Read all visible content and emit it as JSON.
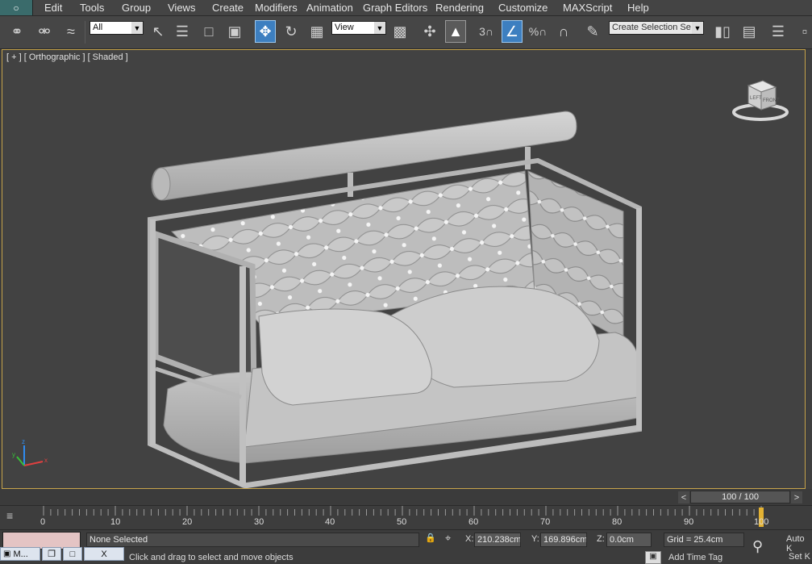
{
  "menu": {
    "items": [
      "Edit",
      "Tools",
      "Group",
      "Views",
      "Create",
      "Modifiers",
      "Animation",
      "Graph Editors",
      "Rendering",
      "Customize",
      "MAXScript",
      "Help"
    ]
  },
  "toolbar": {
    "filter_value": "All",
    "coord_value": "View",
    "snap_label": "3",
    "named_selection_placeholder": "Create Selection Se"
  },
  "viewport": {
    "label": "[ + ] [ Orthographic ] [ Shaded ]",
    "viewcube_face": "FRONT",
    "viewcube_left_face": "LEFT"
  },
  "time_slider": {
    "value": "100 / 100",
    "prev": "<",
    "next": ">"
  },
  "trackbar": {
    "ticks": [
      "0",
      "10",
      "20",
      "30",
      "40",
      "50",
      "60",
      "70",
      "80",
      "90",
      "100"
    ],
    "current_frame": 100
  },
  "status": {
    "selection": "None Selected",
    "prompt": "Click and drag to select and move objects",
    "x_label": "X:",
    "x_value": "210.238cm",
    "y_label": "Y:",
    "y_value": "169.896cm",
    "z_label": "Z:",
    "z_value": "0.0cm",
    "grid": "Grid = 25.4cm",
    "add_time_tag": "Add Time Tag",
    "auto_key": "Auto K",
    "set_key": "Set K"
  },
  "taskbar": {
    "item1": "M...",
    "close": "X"
  },
  "axis": {
    "x": "x",
    "y": "y",
    "z": "z"
  },
  "colors": {
    "viewport_border": "#c7a44b",
    "active_button": "#3d7fc0",
    "time_marker": "#e3b233"
  }
}
